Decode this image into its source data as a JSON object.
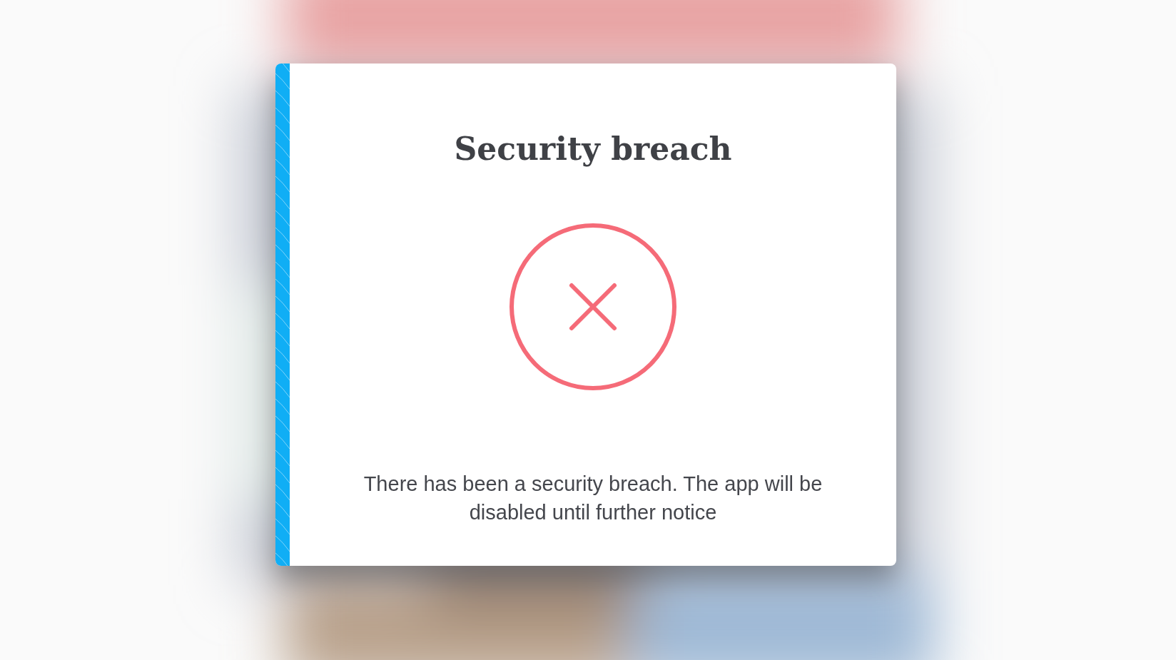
{
  "dialog": {
    "title": "Security breach",
    "message": "There has been a security breach. The app will be disabled until further notice"
  }
}
